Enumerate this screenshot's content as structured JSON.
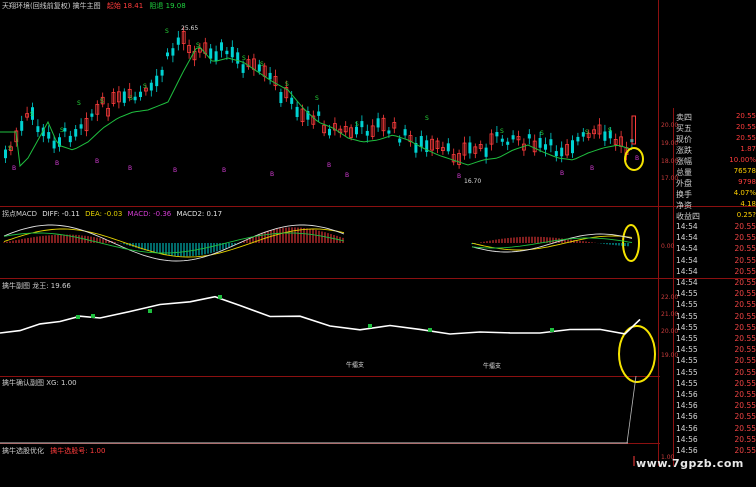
{
  "main_pane": {
    "title": "天翔环境(回线前复权) 擒牛主图",
    "limit_up_label": "起始 18.41",
    "confirm_label": "阻退 19.08",
    "peak_label": "25.65",
    "low_label": "16.70",
    "signal_buy": "B",
    "signal_sell": "S"
  },
  "macd_pane": {
    "title": "拐点MACD",
    "diff": "DIFF: -0.11",
    "dea": "DEA: -0.03",
    "macd": "MACD: -0.36",
    "macd2": "MACD2: 0.17"
  },
  "sub_pane": {
    "title": "擒牛副图 龙王: 19.66",
    "marker_text": "牛擂支",
    "marker_text2": "牛擂支"
  },
  "confirm_pane": {
    "title": "擒牛确认副图 XG: 1.00"
  },
  "select_pane": {
    "title": "擒牛选股优化",
    "value": "擒牛选股号: 1.00"
  },
  "axis": {
    "main": [
      "20.00",
      "19.00",
      "18.00",
      "17.00"
    ],
    "macd": [
      "0.00"
    ],
    "sub": [
      "22.00",
      "21.00",
      "20.00",
      "19.00"
    ],
    "select": [
      "1.00"
    ]
  },
  "quote_labels": [
    "卖四",
    "买五",
    "现价",
    "涨跌",
    "涨幅",
    "总量",
    "外盘",
    "换手",
    "净资",
    "收益四"
  ],
  "quote_values": [
    "20.55",
    "20.55",
    "20.55",
    "1.87",
    "10.00%",
    "76578",
    "9798",
    "4.07%",
    "4.18",
    "0.25?"
  ],
  "ticks": [
    {
      "time": "14:54",
      "val": "20.55"
    },
    {
      "time": "14:54",
      "val": "20.55"
    },
    {
      "time": "14:54",
      "val": "20.55"
    },
    {
      "time": "14:54",
      "val": "20.55"
    },
    {
      "time": "14:54",
      "val": "20.55"
    },
    {
      "time": "14:54",
      "val": "20.55"
    },
    {
      "time": "14:55",
      "val": "20.55"
    },
    {
      "time": "14:55",
      "val": "20.55"
    },
    {
      "time": "14:55",
      "val": "20.55"
    },
    {
      "time": "14:55",
      "val": "20.55"
    },
    {
      "time": "14:55",
      "val": "20.55"
    },
    {
      "time": "14:55",
      "val": "20.55"
    },
    {
      "time": "14:55",
      "val": "20.55"
    },
    {
      "time": "14:55",
      "val": "20.55"
    },
    {
      "time": "14:55",
      "val": "20.55"
    },
    {
      "time": "14:56",
      "val": "20.55"
    },
    {
      "time": "14:56",
      "val": "20.55"
    },
    {
      "time": "14:56",
      "val": "20.55"
    },
    {
      "time": "14:56",
      "val": "20.55"
    },
    {
      "time": "14:56",
      "val": "20.55"
    },
    {
      "time": "14:56",
      "val": "20.55"
    }
  ],
  "watermark": "www.7gpzb.com",
  "colors": {
    "up": "#ff3c3c",
    "down": "#00d2d2",
    "ma": "#1fbf3f",
    "highlight": "#f5e300",
    "line": "#ffffff"
  }
}
